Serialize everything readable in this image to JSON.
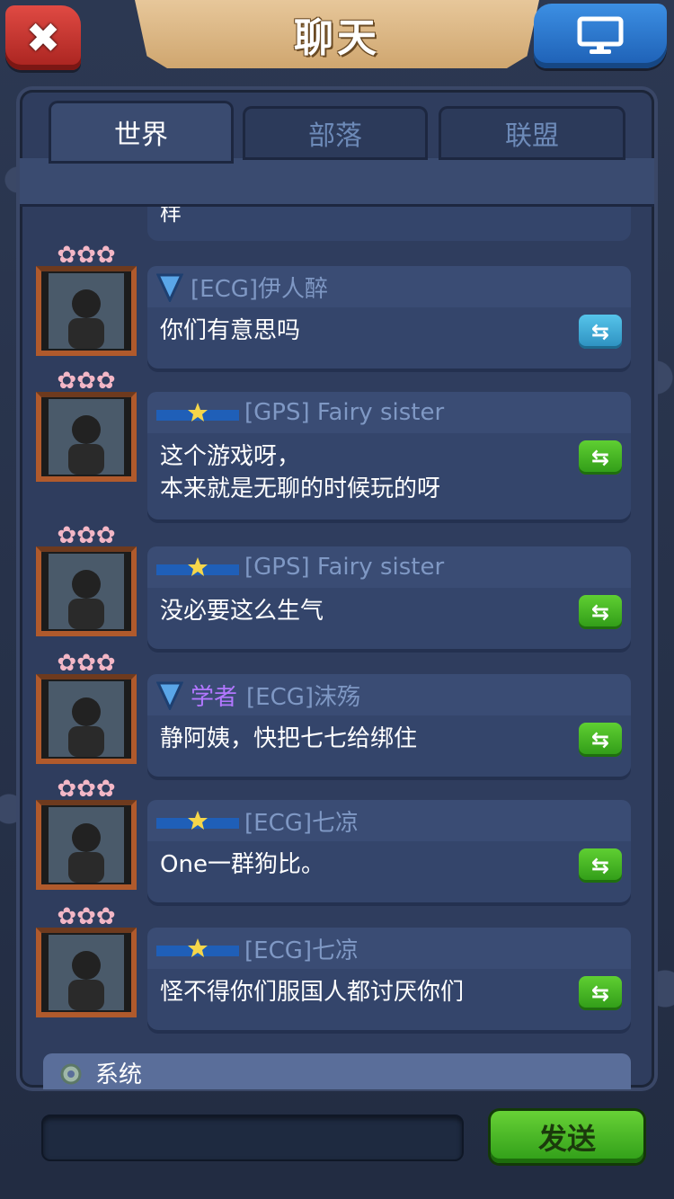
{
  "header": {
    "title": "聊天",
    "close_icon": "close-x-icon",
    "screen_icon": "monitor-icon"
  },
  "tabs": [
    {
      "label": "世界",
      "active": true
    },
    {
      "label": "部落",
      "active": false
    },
    {
      "label": "联盟",
      "active": false
    }
  ],
  "partial_message": {
    "text": "样"
  },
  "messages": [
    {
      "badge": "shield",
      "title": "",
      "name": "[ECG]伊人醉",
      "lines": [
        "你们有意思吗"
      ],
      "reply_color": "blue"
    },
    {
      "badge": "ribbon-star",
      "title": "",
      "name": "[GPS] Fairy sister",
      "lines": [
        "这个游戏呀，",
        "本来就是无聊的时候玩的呀"
      ],
      "reply_color": "green"
    },
    {
      "badge": "ribbon-star",
      "title": "",
      "name": "[GPS] Fairy sister",
      "lines": [
        "没必要这么生气"
      ],
      "reply_color": "green"
    },
    {
      "badge": "shield",
      "title": "学者",
      "name": "[ECG]沫殇",
      "lines": [
        "静阿姨，快把七七给绑住"
      ],
      "reply_color": "green"
    },
    {
      "badge": "ribbon-star",
      "title": "",
      "name": "[ECG]七凉",
      "lines": [
        "One一群狗比。"
      ],
      "reply_color": "green"
    },
    {
      "badge": "ribbon-star",
      "title": "",
      "name": "[ECG]七凉",
      "lines": [
        "怪不得你们服国人都讨厌你们"
      ],
      "reply_color": "green"
    }
  ],
  "reply_glyph": "⇆",
  "system": {
    "label": "系统",
    "icon": "gear-icon"
  },
  "input": {
    "value": "",
    "placeholder": ""
  },
  "send_button": {
    "label": "发送"
  },
  "colors": {
    "green_button": "#3fb020",
    "blue_button": "#3aa6d6",
    "scholar_title": "#b277ff",
    "name_text": "#7f98c4"
  }
}
